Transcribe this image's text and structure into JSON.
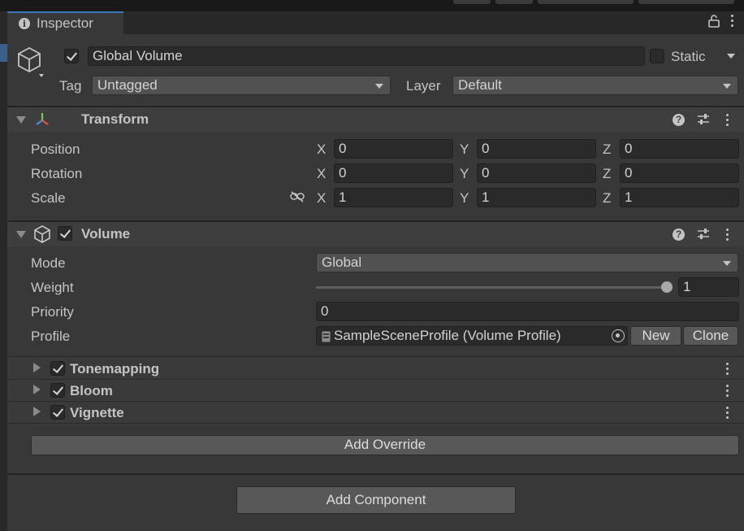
{
  "window": {
    "tab_title": "Inspector"
  },
  "gameobject": {
    "name": "Global Volume",
    "active": true,
    "static_label": "Static",
    "static_checked": false,
    "tag_label": "Tag",
    "tag_value": "Untagged",
    "layer_label": "Layer",
    "layer_value": "Default"
  },
  "transform": {
    "title": "Transform",
    "rows": [
      {
        "label": "Position",
        "x": "0",
        "y": "0",
        "z": "0"
      },
      {
        "label": "Rotation",
        "x": "0",
        "y": "0",
        "z": "0"
      },
      {
        "label": "Scale",
        "x": "1",
        "y": "1",
        "z": "1"
      }
    ],
    "axis": {
      "x": "X",
      "y": "Y",
      "z": "Z"
    }
  },
  "volume": {
    "title": "Volume",
    "enabled": true,
    "mode_label": "Mode",
    "mode_value": "Global",
    "weight_label": "Weight",
    "weight_value": "1",
    "weight_fraction": 1.0,
    "priority_label": "Priority",
    "priority_value": "0",
    "profile_label": "Profile",
    "profile_value": "SampleSceneProfile (Volume Profile)",
    "new_button": "New",
    "clone_button": "Clone",
    "overrides": [
      {
        "label": "Tonemapping",
        "enabled": true
      },
      {
        "label": "Bloom",
        "enabled": true
      },
      {
        "label": "Vignette",
        "enabled": true
      }
    ],
    "add_override": "Add Override"
  },
  "add_component": "Add Component",
  "colors": {
    "panel": "#383838",
    "header": "#3e3e3e",
    "field": "#2a2a2a",
    "accent": "#3a79bb"
  }
}
